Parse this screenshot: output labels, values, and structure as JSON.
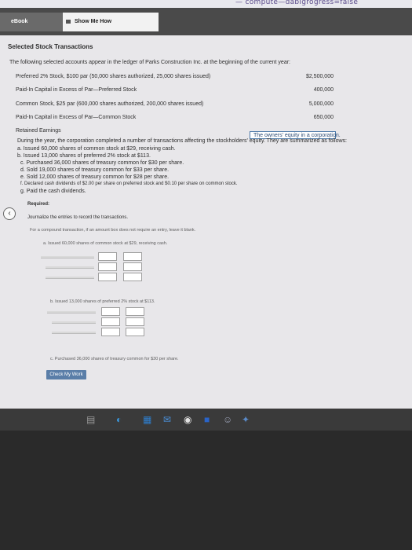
{
  "url_fragment": "— compute—dabigrogress=false",
  "tabs": {
    "ebook": "eBook",
    "show_me_how": "Show Me How"
  },
  "problem": {
    "title": "Selected Stock Transactions",
    "intro": "The following selected accounts appear in the ledger of Parks Construction Inc. at the beginning of the current year:",
    "accounts": [
      {
        "name": "Preferred 2% Stock, $100 par (50,000 shares authorized, 25,000 shares issued)",
        "amount": "$2,500,000"
      },
      {
        "name": "Paid-In Capital in Excess of Par—Preferred Stock",
        "amount": "400,000"
      },
      {
        "name": "Common Stock, $25 par (600,000 shares authorized, 200,000 shares issued)",
        "amount": "5,000,000"
      },
      {
        "name": "Paid-In Capital in Excess of Par—Common Stock",
        "amount": "650,000"
      },
      {
        "name": "Retained Earnings",
        "amount": ""
      }
    ],
    "callout": "The owners' equity in a corporation.",
    "during_year": "During the year, the corporation completed a number of transactions affecting the stockholders' equity. They are summarized as follows:",
    "transactions": [
      "a. Issued 60,000 shares of common stock at $29, receiving cash.",
      "b. Issued 13,000 shares of preferred 2% stock at $113.",
      "c. Purchased 36,000 shares of treasury common for $30 per share.",
      "d. Sold 19,000 shares of treasury common for $33 per share.",
      "e. Sold 12,000 shares of treasury common for $28 per share.",
      "f. Declared cash dividends of $2.00 per share on preferred stock and $0.10 per share on common stock.",
      "g. Paid the cash dividends."
    ],
    "required_label": "Required:",
    "journalize": "Journalize the entries to record the transactions.",
    "instruction": "For a compound transaction, if an amount box does not require an entry, leave it blank.",
    "entries": {
      "a": "a. Issued 60,000 shares of common stock at $29, receiving cash.",
      "b": "b. Issued 13,000 shares of preferred 2% stock at $113.",
      "c": "c. Purchased 36,000 shares of treasury common for $30 per share."
    },
    "check_button": "Check My Work"
  },
  "icons": [
    "back-chevron-icon",
    "file-explorer-icon",
    "edge-icon",
    "chrome-icon",
    "mail-icon",
    "store-icon",
    "word-icon",
    "app-icon"
  ]
}
